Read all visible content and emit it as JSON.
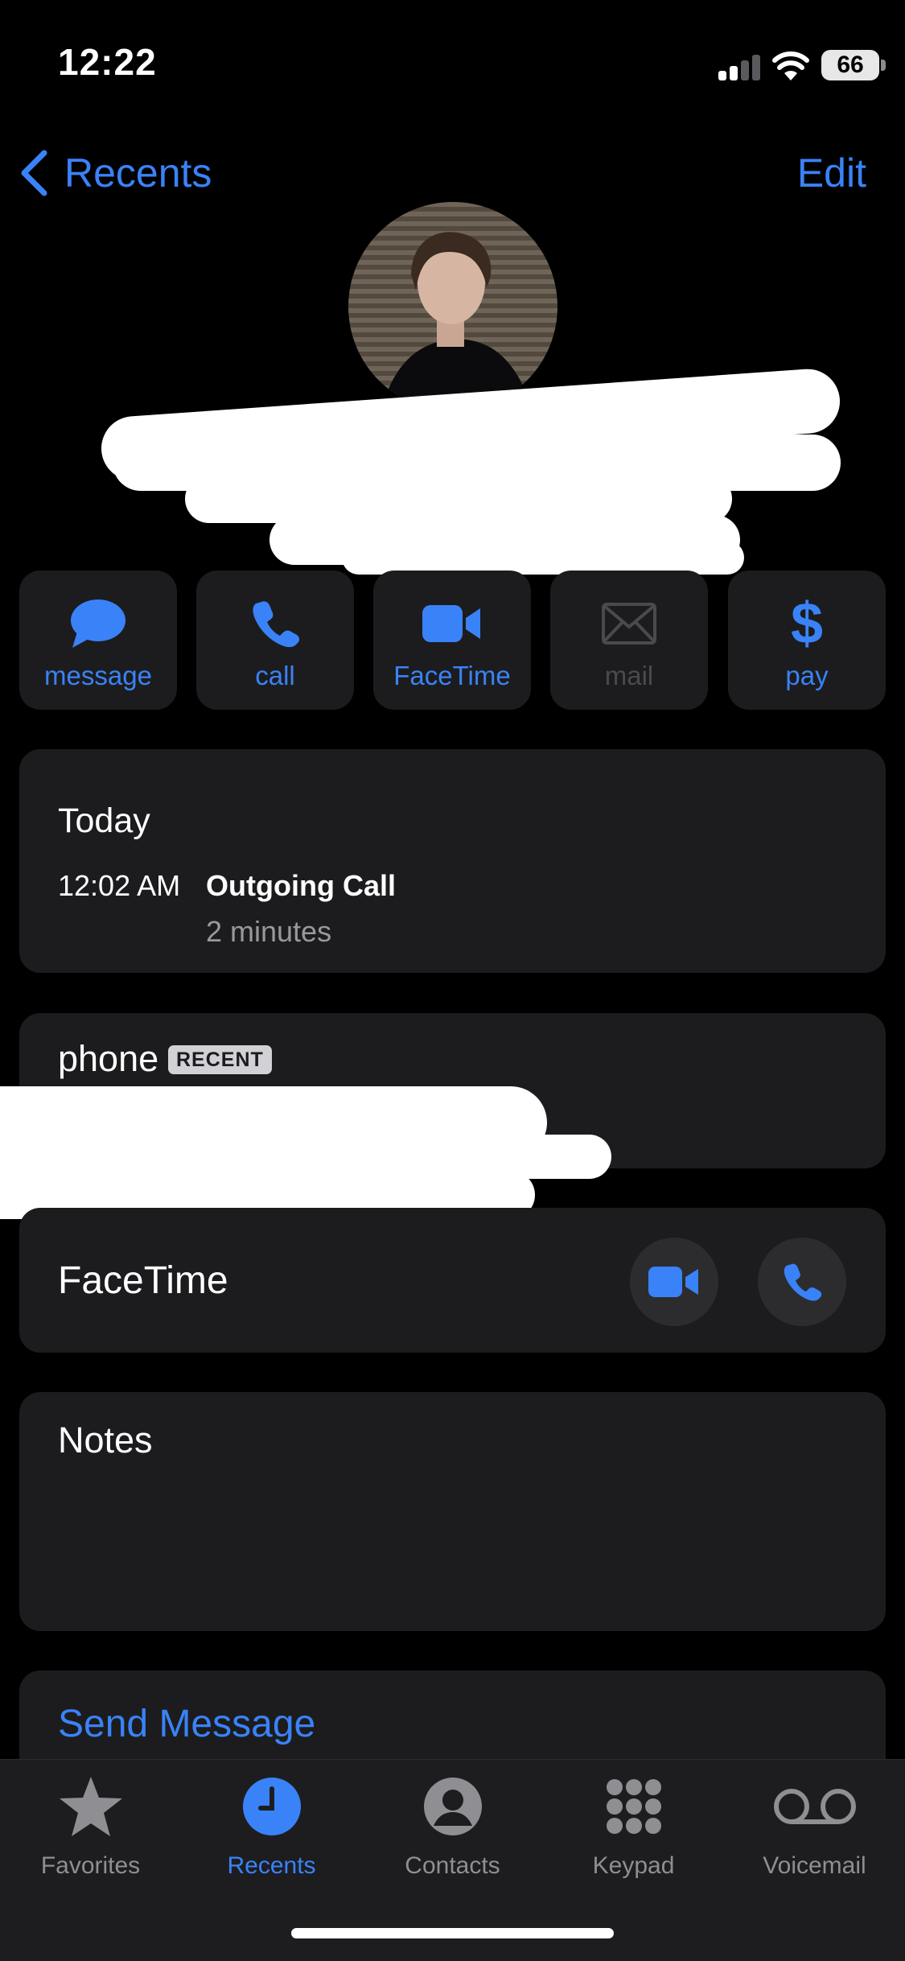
{
  "status_bar": {
    "time": "12:22",
    "battery": "66"
  },
  "nav": {
    "back_label": "Recents",
    "edit_label": "Edit"
  },
  "actions": [
    {
      "label": "message",
      "icon": "message-bubble-icon",
      "enabled": true
    },
    {
      "label": "call",
      "icon": "phone-icon",
      "enabled": true
    },
    {
      "label": "FaceTime",
      "icon": "video-camera-icon",
      "enabled": true
    },
    {
      "label": "mail",
      "icon": "envelope-icon",
      "enabled": false
    },
    {
      "label": "pay",
      "icon": "dollar-icon",
      "enabled": true
    }
  ],
  "call_history": {
    "date_heading": "Today",
    "entries": [
      {
        "time": "12:02 AM",
        "type": "Outgoing Call",
        "duration": "2 minutes"
      }
    ]
  },
  "phone": {
    "label": "phone",
    "badge": "RECENT"
  },
  "facetime": {
    "label": "FaceTime"
  },
  "notes": {
    "label": "Notes"
  },
  "send_message": {
    "label": "Send Message"
  },
  "tabs": [
    {
      "label": "Favorites",
      "icon": "star-icon",
      "active": false
    },
    {
      "label": "Recents",
      "icon": "clock-icon",
      "active": true
    },
    {
      "label": "Contacts",
      "icon": "person-circle-icon",
      "active": false
    },
    {
      "label": "Keypad",
      "icon": "keypad-icon",
      "active": false
    },
    {
      "label": "Voicemail",
      "icon": "voicemail-icon",
      "active": false
    }
  ],
  "colors": {
    "accent": "#3a82f7",
    "background": "#000000",
    "card": "#1c1c1e",
    "secondary_text": "#98989d"
  }
}
